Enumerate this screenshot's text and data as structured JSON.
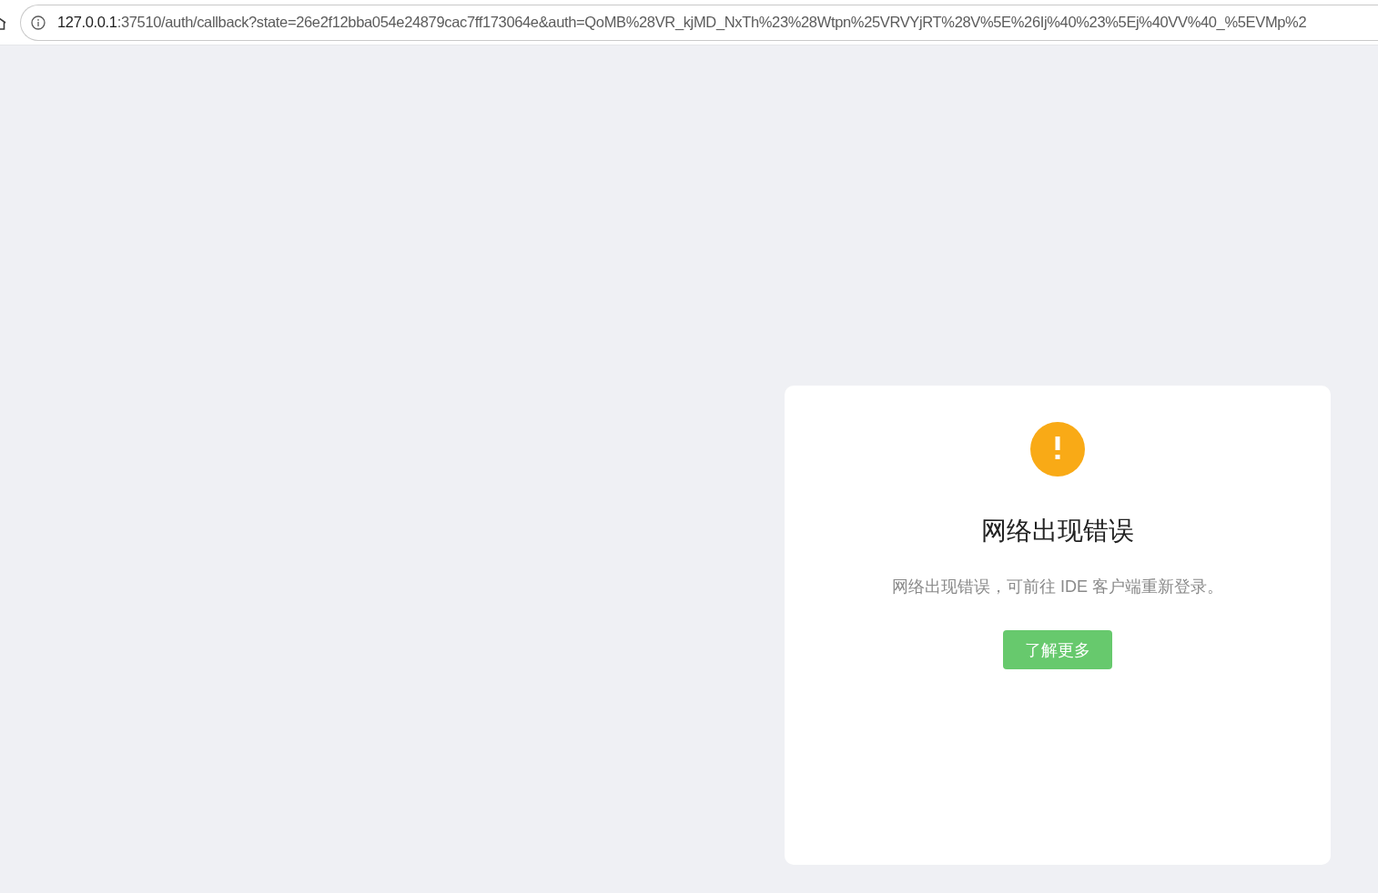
{
  "address_bar": {
    "host": "127.0.0.1",
    "path": ":37510/auth/callback?state=26e2f12bba054e24879cac7ff173064e&auth=QoMB%28VR_kjMD_NxTh%23%28Wtpn%25VRVYjRT%28V%5E%26Ij%40%23%5Ej%40VV%40_%5EVMp%2"
  },
  "message_card": {
    "title": "网络出现错误",
    "description": "网络出现错误，可前往 IDE 客户端重新登录。",
    "button": "了解更多"
  }
}
